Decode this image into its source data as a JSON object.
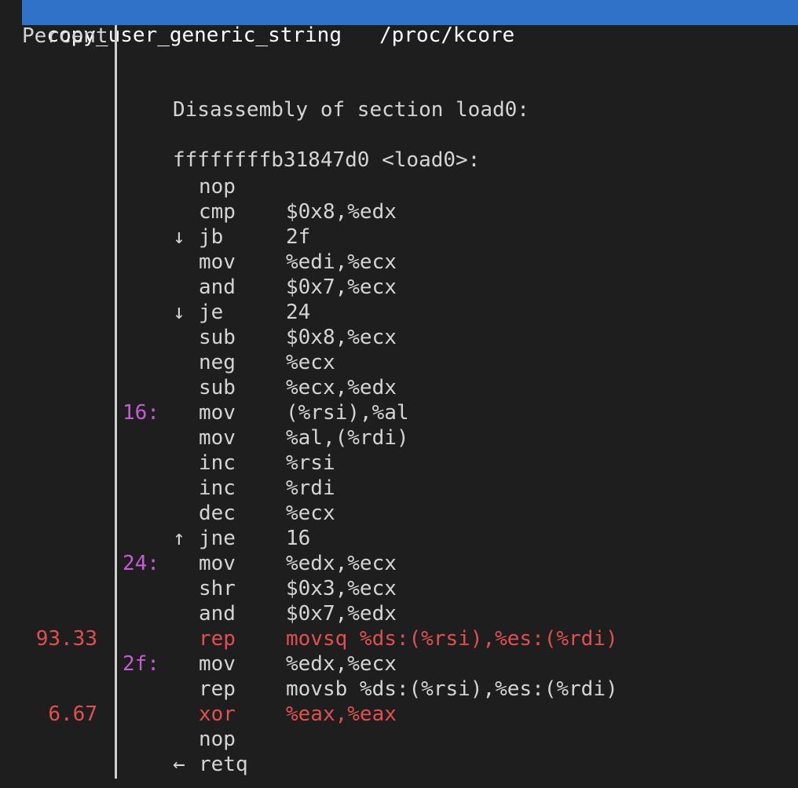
{
  "title": {
    "function": "copy_user_generic_string",
    "dso": "/proc/kcore"
  },
  "column_header": "Percent",
  "section_title": "Disassembly of section load0:",
  "function_header": "ffffffffb31847d0 <load0>:",
  "colors": {
    "background": "#1e1e1e",
    "title_bar": "#2f73c9",
    "hot": "#e05050",
    "label": "#c65bd6"
  },
  "rows": [
    {
      "percent": "",
      "label": "",
      "arrow": "",
      "mnemonic": "nop",
      "operands": ""
    },
    {
      "percent": "",
      "label": "",
      "arrow": "",
      "mnemonic": "cmp",
      "operands": "$0x8,%edx"
    },
    {
      "percent": "",
      "label": "",
      "arrow": "↓",
      "mnemonic": "jb",
      "operands": "2f"
    },
    {
      "percent": "",
      "label": "",
      "arrow": "",
      "mnemonic": "mov",
      "operands": "%edi,%ecx"
    },
    {
      "percent": "",
      "label": "",
      "arrow": "",
      "mnemonic": "and",
      "operands": "$0x7,%ecx"
    },
    {
      "percent": "",
      "label": "",
      "arrow": "↓",
      "mnemonic": "je",
      "operands": "24"
    },
    {
      "percent": "",
      "label": "",
      "arrow": "",
      "mnemonic": "sub",
      "operands": "$0x8,%ecx"
    },
    {
      "percent": "",
      "label": "",
      "arrow": "",
      "mnemonic": "neg",
      "operands": "%ecx"
    },
    {
      "percent": "",
      "label": "",
      "arrow": "",
      "mnemonic": "sub",
      "operands": "%ecx,%edx"
    },
    {
      "percent": "",
      "label": "16:",
      "arrow": "",
      "mnemonic": "mov",
      "operands": "(%rsi),%al"
    },
    {
      "percent": "",
      "label": "",
      "arrow": "",
      "mnemonic": "mov",
      "operands": "%al,(%rdi)"
    },
    {
      "percent": "",
      "label": "",
      "arrow": "",
      "mnemonic": "inc",
      "operands": "%rsi"
    },
    {
      "percent": "",
      "label": "",
      "arrow": "",
      "mnemonic": "inc",
      "operands": "%rdi"
    },
    {
      "percent": "",
      "label": "",
      "arrow": "",
      "mnemonic": "dec",
      "operands": "%ecx"
    },
    {
      "percent": "",
      "label": "",
      "arrow": "↑",
      "mnemonic": "jne",
      "operands": "16"
    },
    {
      "percent": "",
      "label": "24:",
      "arrow": "",
      "mnemonic": "mov",
      "operands": "%edx,%ecx"
    },
    {
      "percent": "",
      "label": "",
      "arrow": "",
      "mnemonic": "shr",
      "operands": "$0x3,%ecx"
    },
    {
      "percent": "",
      "label": "",
      "arrow": "",
      "mnemonic": "and",
      "operands": "$0x7,%edx"
    },
    {
      "percent": "93.33",
      "label": "",
      "arrow": "",
      "mnemonic": "rep",
      "operands": "movsq %ds:(%rsi),%es:(%rdi)",
      "hot": true
    },
    {
      "percent": "",
      "label": "2f:",
      "arrow": "",
      "mnemonic": "mov",
      "operands": "%edx,%ecx"
    },
    {
      "percent": "",
      "label": "",
      "arrow": "",
      "mnemonic": "rep",
      "operands": "movsb %ds:(%rsi),%es:(%rdi)"
    },
    {
      "percent": "6.67",
      "label": "",
      "arrow": "",
      "mnemonic": "xor",
      "operands": "%eax,%eax",
      "hot": true
    },
    {
      "percent": "",
      "label": "",
      "arrow": "",
      "mnemonic": "nop",
      "operands": ""
    },
    {
      "percent": "",
      "label": "",
      "arrow": "←",
      "mnemonic": "retq",
      "operands": ""
    }
  ]
}
